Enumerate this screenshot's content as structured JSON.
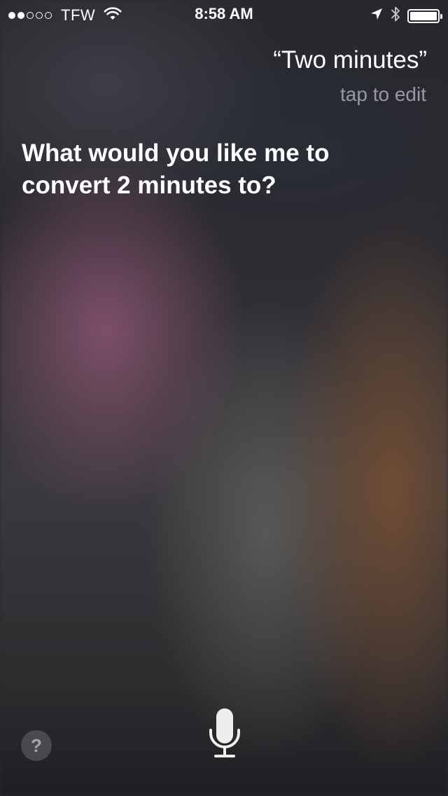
{
  "status_bar": {
    "signal_bars_filled": 2,
    "signal_bars_total": 5,
    "carrier": "TFW",
    "time": "8:58 AM",
    "battery_level": 1.0,
    "icons": [
      "wifi-icon",
      "location-arrow-icon",
      "bluetooth-icon",
      "battery-icon"
    ]
  },
  "siri": {
    "utterance": "“Two minutes”",
    "tap_to_edit": "tap to edit",
    "response": "What would you like me to convert 2 minutes to?"
  },
  "controls": {
    "help_label": "?",
    "help_icon": "question-mark-icon",
    "mic_icon": "microphone-icon"
  },
  "colors": {
    "text": "#ffffff",
    "secondary_text": "#b4b4be"
  }
}
